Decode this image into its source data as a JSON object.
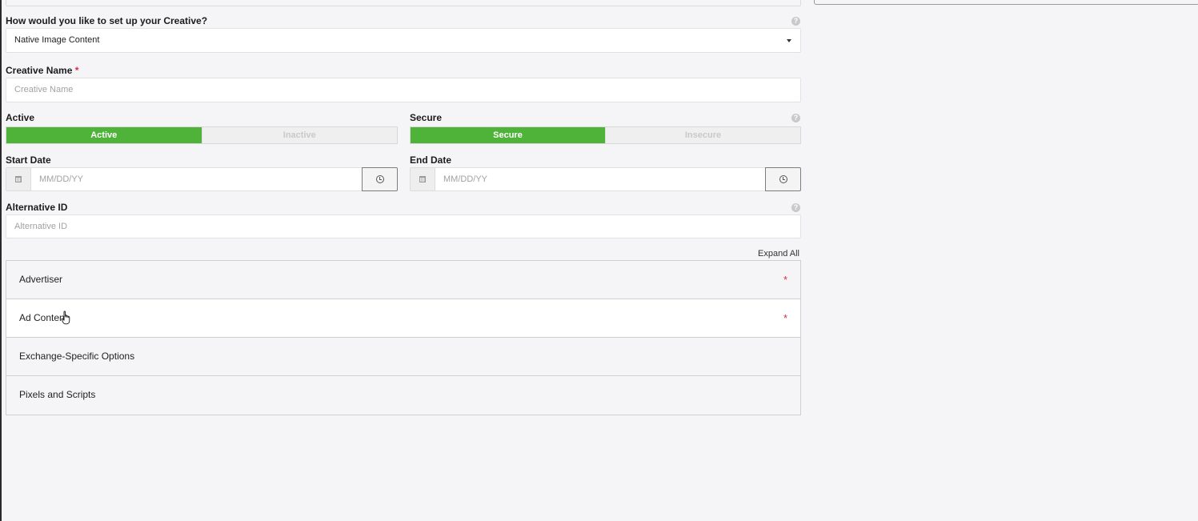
{
  "setup": {
    "question": "How would you like to set up your Creative?",
    "selected": "Native Image Content"
  },
  "creative_name": {
    "label": "Creative Name",
    "required_mark": "*",
    "placeholder": "Creative Name"
  },
  "active": {
    "label": "Active",
    "on": "Active",
    "off": "Inactive"
  },
  "secure": {
    "label": "Secure",
    "on": "Secure",
    "off": "Insecure"
  },
  "start_date": {
    "label": "Start Date",
    "placeholder": "MM/DD/YY"
  },
  "end_date": {
    "label": "End Date",
    "placeholder": "MM/DD/YY"
  },
  "alternative_id": {
    "label": "Alternative ID",
    "placeholder": "Alternative ID"
  },
  "expand_all": "Expand All",
  "sections": [
    {
      "title": "Advertiser",
      "required_mark": "*"
    },
    {
      "title": "Ad Content",
      "required_mark": "*"
    },
    {
      "title": "Exchange-Specific Options"
    },
    {
      "title": "Pixels and Scripts"
    }
  ],
  "help_icon": "?",
  "colors": {
    "toggle_on": "#4fb339",
    "required": "#d9303a",
    "background": "#f5f4f6"
  },
  "icons": [
    "help-icon",
    "calendar-icon",
    "clock-icon",
    "chevron-down-icon",
    "hand-cursor-icon"
  ]
}
